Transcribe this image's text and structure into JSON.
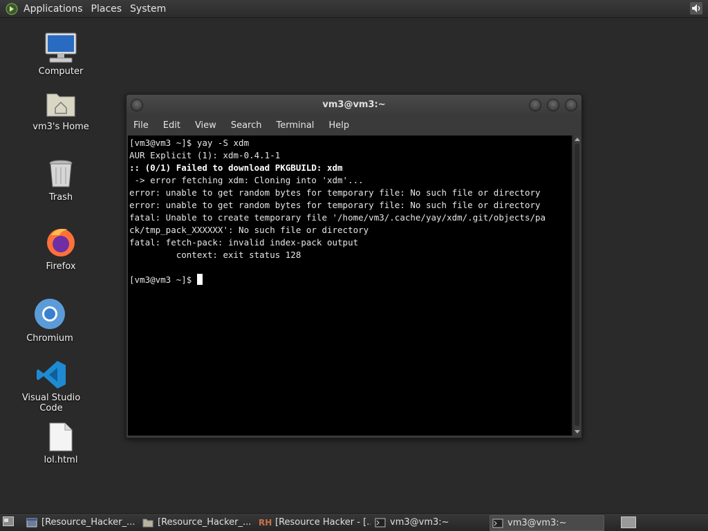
{
  "top_panel": {
    "menus": [
      "Applications",
      "Places",
      "System"
    ]
  },
  "desktop_icons": [
    {
      "label": "Computer"
    },
    {
      "label": "vm3's Home"
    },
    {
      "label": "Trash"
    },
    {
      "label": "Firefox"
    },
    {
      "label": "Chromium"
    },
    {
      "label": "Visual Studio Code"
    },
    {
      "label": "lol.html"
    }
  ],
  "terminal": {
    "title": "vm3@vm3:~",
    "menu": [
      "File",
      "Edit",
      "View",
      "Search",
      "Terminal",
      "Help"
    ],
    "lines": [
      "[vm3@vm3 ~]$ yay -S xdm",
      "AUR Explicit (1): xdm-0.4.1-1",
      ":: (0/1) Failed to download PKGBUILD: xdm",
      " -> error fetching xdm: Cloning into 'xdm'...",
      "error: unable to get random bytes for temporary file: No such file or directory",
      "error: unable to get random bytes for temporary file: No such file or directory",
      "fatal: Unable to create temporary file '/home/vm3/.cache/yay/xdm/.git/objects/pa",
      "ck/tmp_pack_XXXXXX': No such file or directory",
      "fatal: fetch-pack: invalid index-pack output",
      "         context: exit status 128",
      "",
      "[vm3@vm3 ~]$ "
    ]
  },
  "taskbar": {
    "tasks": [
      {
        "label": "[Resource_Hacker_...",
        "icon": "window-icon"
      },
      {
        "label": "[Resource_Hacker_...",
        "icon": "folder-icon"
      },
      {
        "label": "[Resource Hacker - [...",
        "icon": "rh-icon"
      },
      {
        "label": "vm3@vm3:~",
        "icon": "terminal-icon"
      },
      {
        "label": "vm3@vm3:~",
        "icon": "terminal-icon",
        "active": true
      }
    ],
    "rh_icon_text": "RH"
  },
  "colors": {
    "desktop_bg": "#2a2a2a",
    "terminal_bg": "#000000",
    "terminal_fg": "#e6e6e6"
  }
}
